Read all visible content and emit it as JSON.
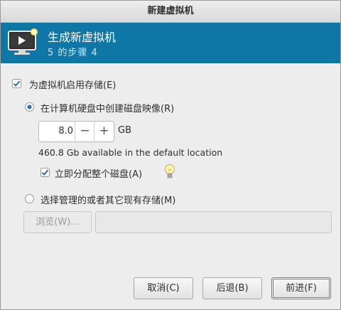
{
  "window": {
    "title": "新建虚拟机"
  },
  "banner": {
    "title": "生成新虚拟机",
    "step": "5 的步骤 4"
  },
  "storage": {
    "enable_label": "为虚拟机启用存储(E)",
    "enable_checked": true,
    "create_option_label": "在计算机硬盘中创建磁盘映像(R)",
    "create_selected": true,
    "disk_size": "8.0",
    "size_unit": "GB",
    "minus": "−",
    "plus": "+",
    "available_text": "460.8 Gb available in the default location",
    "allocate_label": "立即分配整个磁盘(A)",
    "allocate_checked": true,
    "existing_option_label": "选择管理的或者其它现有存储(M)",
    "existing_selected": false,
    "browse_label": "浏览(W)...",
    "path_value": ""
  },
  "buttons": {
    "cancel": "取消(C)",
    "back": "后退(B)",
    "forward": "前进(F)"
  }
}
